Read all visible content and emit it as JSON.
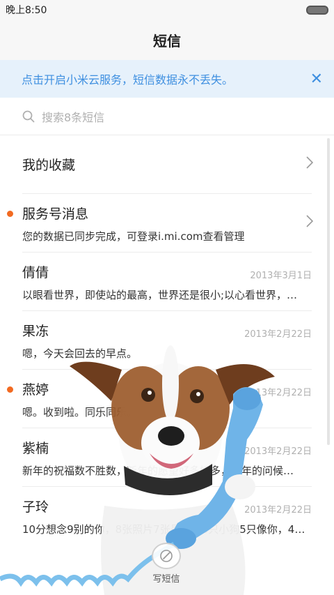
{
  "status_bar": {
    "time": "晚上8:50",
    "battery_icon": "battery-icon"
  },
  "header": {
    "title": "短信"
  },
  "banner": {
    "text": "点击开启小米云服务，短信数据永不丢失。",
    "close_icon": "close-icon",
    "color": "#3e8fe0",
    "background": "#e6f1fb"
  },
  "search": {
    "placeholder": "搜索8条短信",
    "icon": "search-icon"
  },
  "conversations": [
    {
      "name": "我的收藏",
      "snippet": "",
      "date": "",
      "unread": false,
      "chevron": true
    },
    {
      "name": "服务号消息",
      "snippet": "您的数据已同步完成，可登录i.mi.com查看管理",
      "date": "",
      "unread": true,
      "chevron": true
    },
    {
      "name": "倩倩",
      "snippet": "以眼看世界，即使站的最高，世界还是很小;以心看世界，…",
      "date": "2013年3月1日",
      "unread": false,
      "chevron": false
    },
    {
      "name": "果冻",
      "snippet": "嗯，今天会回去的早点。",
      "date": "2013年2月22日",
      "unread": false,
      "chevron": false
    },
    {
      "name": "燕婷",
      "snippet": "嗯。收到啦。同乐同乐。",
      "date": "2013年2月22日",
      "unread": true,
      "chevron": false
    },
    {
      "name": "紫楠",
      "snippet": "新年的祝福数不胜数，新年的愿望好多好多，新年的问候…",
      "date": "2013年2月22日",
      "unread": false,
      "chevron": false
    },
    {
      "name": "子玲",
      "snippet": "10分想念9别的你，8张照片7张是你，6只小狗5只像你，4…",
      "date": "2013年2月22日",
      "unread": false,
      "chevron": false
    }
  ],
  "compose": {
    "label": "写短信",
    "icon": "compose-icon"
  },
  "colors": {
    "unread_dot": "#f26a21",
    "date_gray": "#b0b0b0"
  }
}
